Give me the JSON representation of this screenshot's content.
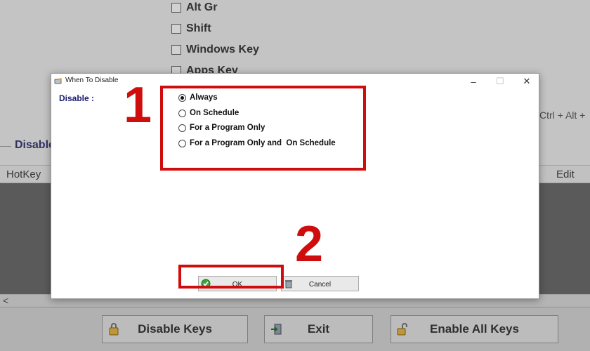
{
  "background": {
    "checkboxes": [
      "Alt Gr",
      "Shift",
      "Windows Key",
      "Apps Key"
    ],
    "ctrl_hint": "Ctrl + Alt +",
    "group_title": "Disable",
    "columns": {
      "hotkey": "HotKey",
      "edit": "Edit"
    },
    "scroll_left": "<",
    "buttons": {
      "disable_keys": "Disable Keys",
      "exit": "Exit",
      "enable_all_keys": "Enable All Keys"
    }
  },
  "dialog": {
    "title": "When To Disable",
    "minimize": "–",
    "maximize": "☐",
    "close": "✕",
    "disable_label": "Disable :",
    "options": [
      {
        "label": "Always",
        "selected": true
      },
      {
        "label": "On Schedule",
        "selected": false
      },
      {
        "label": "For a Program Only",
        "selected": false
      },
      {
        "label": "For a Program Only and  On Schedule",
        "selected": false
      }
    ],
    "ok_label": "OK",
    "cancel_label": "Cancel"
  },
  "annotations": {
    "step1": "1",
    "step2": "2",
    "color": "#d00d0d"
  }
}
